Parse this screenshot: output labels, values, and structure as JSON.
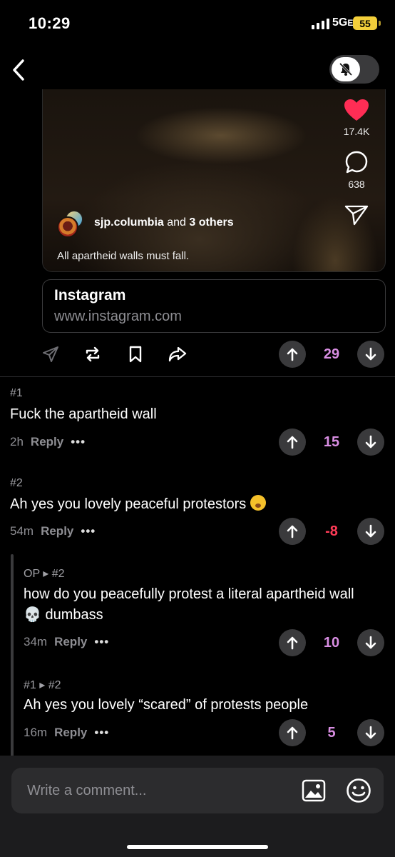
{
  "status_bar": {
    "time": "10:29",
    "network": "5G",
    "network_suffix": "E",
    "battery": "55"
  },
  "post": {
    "video": {
      "likes": "17.4K",
      "comments": "638",
      "username": "sjp.columbia",
      "collab_text": "and",
      "collab_others": "3 others",
      "caption": "All apartheid walls must fall."
    },
    "link": {
      "title": "Instagram",
      "url": "www.instagram.com"
    },
    "score": "29"
  },
  "comments": [
    {
      "num": "#1",
      "text": "Fuck the apartheid wall",
      "time": "2h",
      "reply": "Reply",
      "more": "•••",
      "score": "15"
    },
    {
      "num": "#2",
      "text": "Ah yes you lovely peaceful protestors",
      "time": "54m",
      "reply": "Reply",
      "more": "•••",
      "score": "-8"
    },
    {
      "num": "OP ▸ #2",
      "text_line1": "how do you peacefully protest a literal apartheid wall",
      "text_line2_emoji": "💀",
      "text_line2": "dumbass",
      "time": "34m",
      "reply": "Reply",
      "more": "•••",
      "score": "10"
    },
    {
      "num": "#1 ▸ #2",
      "text": "Ah yes you lovely “scared” of protests people",
      "time": "16m",
      "reply": "Reply",
      "more": "•••",
      "score": "5"
    }
  ],
  "composer": {
    "placeholder": "Write a comment..."
  },
  "colors": {
    "upvote_score": "#d98ee3",
    "downvote_score": "#ff3b57",
    "heart": "#ff2d55"
  },
  "icons": [
    "back-chevron-icon",
    "bell-slash-icon",
    "heart-icon",
    "comment-bubble-icon",
    "send-icon",
    "share-arrow-icon",
    "repost-icon",
    "bookmark-icon",
    "forward-icon",
    "upvote-icon",
    "downvote-icon",
    "image-icon",
    "smiley-icon"
  ]
}
